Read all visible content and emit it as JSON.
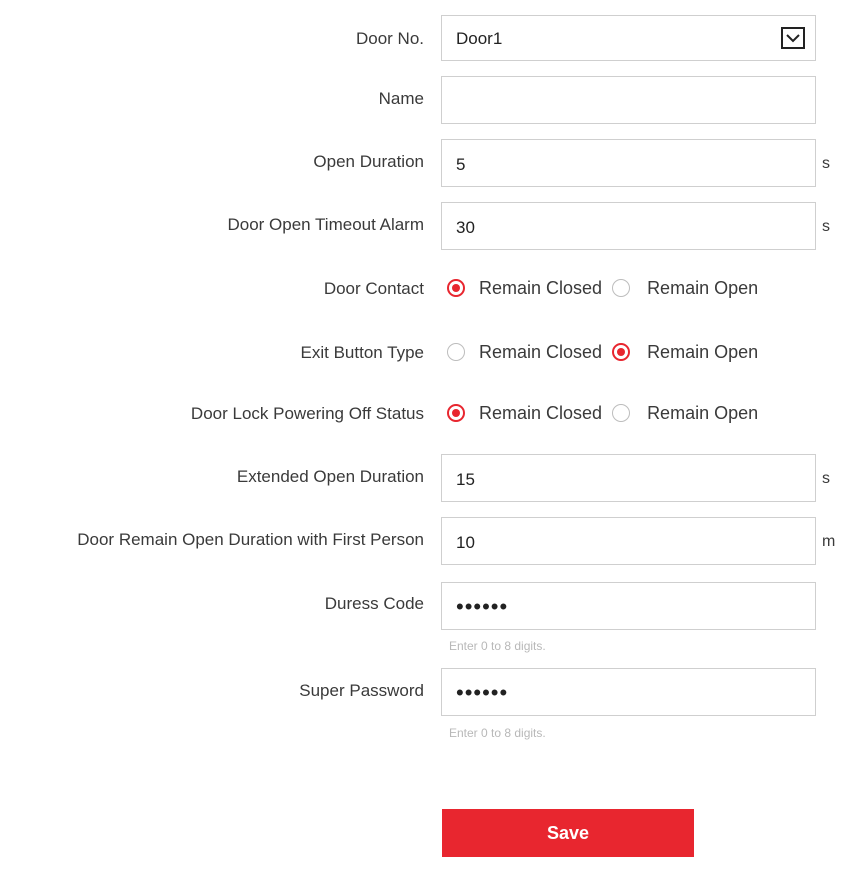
{
  "form": {
    "door_no": {
      "label": "Door No.",
      "value": "Door1"
    },
    "name": {
      "label": "Name",
      "value": ""
    },
    "open_duration": {
      "label": "Open Duration",
      "value": "5",
      "unit": "s"
    },
    "open_timeout_alarm": {
      "label": "Door Open Timeout Alarm",
      "value": "30",
      "unit": "s"
    },
    "door_contact": {
      "label": "Door Contact",
      "options": [
        "Remain Closed",
        "Remain Open"
      ],
      "selected": "Remain Closed"
    },
    "exit_button_type": {
      "label": "Exit Button Type",
      "options": [
        "Remain Closed",
        "Remain Open"
      ],
      "selected": "Remain Open"
    },
    "lock_power_off_status": {
      "label": "Door Lock Powering Off Status",
      "options": [
        "Remain Closed",
        "Remain Open"
      ],
      "selected": "Remain Closed"
    },
    "extended_open_duration": {
      "label": "Extended Open Duration",
      "value": "15",
      "unit": "s"
    },
    "first_person_duration": {
      "label": "Door Remain Open Duration with First Person",
      "value": "10",
      "unit": "m"
    },
    "duress_code": {
      "label": "Duress Code",
      "value": "••••••",
      "hint": "Enter 0 to 8 digits."
    },
    "super_password": {
      "label": "Super Password",
      "value": "••••••",
      "hint": "Enter 0 to 8 digits."
    },
    "save_label": "Save"
  },
  "colors": {
    "accent": "#e8262f",
    "border": "#cfcfcf",
    "text": "#3a3a3a",
    "hint": "#b8b8b8"
  },
  "icons": {
    "dropdown": "chevron-down-icon",
    "radio": "radio-button-icon"
  }
}
